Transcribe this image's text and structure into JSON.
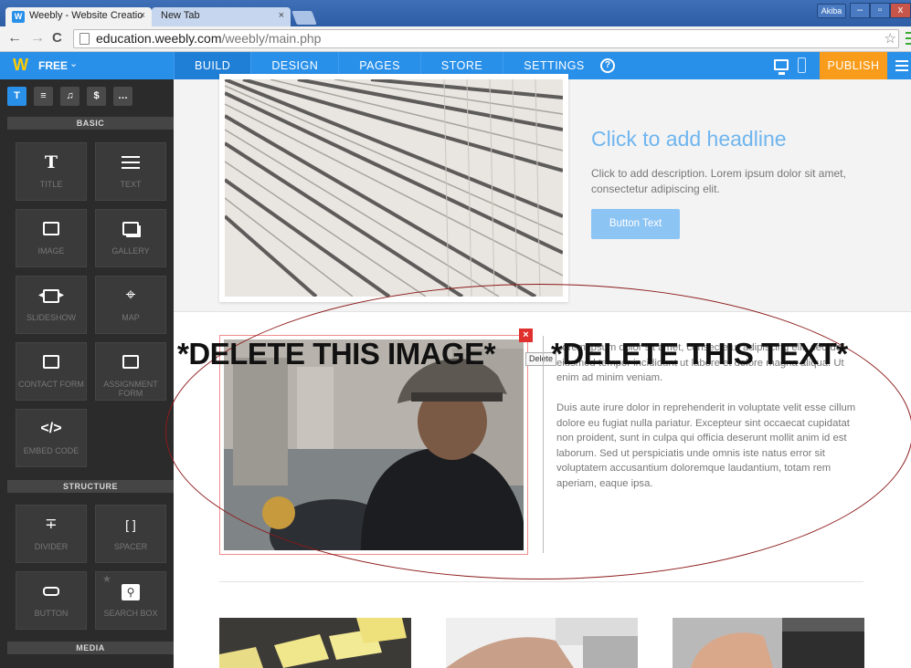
{
  "browser": {
    "active_tab_title": "Weebly - Website Creatio",
    "inactive_tab_title": "New Tab",
    "tab_close": "×",
    "window_user": "Akiba",
    "win_min": "–",
    "win_max": "▫",
    "win_close": "x",
    "url_host": "education.weebly.com",
    "url_path": "/weebly/main.php",
    "back": "←",
    "forward": "→",
    "reload": "C"
  },
  "editor": {
    "logo": "W",
    "plan": "FREE",
    "nav": [
      "BUILD",
      "DESIGN",
      "PAGES",
      "STORE",
      "SETTINGS"
    ],
    "active_nav": "BUILD",
    "help": "?",
    "publish": "PUBLISH",
    "accent": "#2990ea",
    "publish_color": "#f99c1c"
  },
  "sidebar": {
    "tabs": [
      "T",
      "≡",
      "♫",
      "$",
      "…"
    ],
    "sections": {
      "basic": "BASIC",
      "structure": "STRUCTURE",
      "media": "MEDIA"
    },
    "basic": [
      {
        "icon": "T",
        "label": "TITLE"
      },
      {
        "icon": "lines",
        "label": "TEXT"
      },
      {
        "icon": "image",
        "label": "IMAGE"
      },
      {
        "icon": "gallery",
        "label": "GALLERY"
      },
      {
        "icon": "slideshow",
        "label": "SLIDESHOW"
      },
      {
        "icon": "map-pin",
        "label": "MAP"
      },
      {
        "icon": "form",
        "label": "CONTACT FORM"
      },
      {
        "icon": "form",
        "label": "ASSIGNMENT FORM"
      },
      {
        "icon": "</>",
        "label": "EMBED CODE"
      }
    ],
    "structure": [
      {
        "icon": "divider",
        "label": "DIVIDER"
      },
      {
        "icon": "spacer",
        "label": "SPACER"
      },
      {
        "icon": "button",
        "label": "BUTTON"
      },
      {
        "icon": "search",
        "label": "SEARCH BOX"
      }
    ]
  },
  "content": {
    "headline": "Click to add headline",
    "description": "Click to add description. Lorem ipsum dolor sit amet, consectetur adipiscing elit.",
    "button_text": "Button Text",
    "delete_tooltip": "Delete",
    "delete_x": "×",
    "paragraph1": "Lorem ipsum dolor sit amet, consectetur adipiscing elit, sed do eiusmod tempor incididunt ut labore et dolore magna aliqua. Ut enim ad minim veniam.",
    "paragraph2": "Duis aute irure dolor in reprehenderit in voluptate velit esse cillum dolore eu fugiat nulla pariatur. Excepteur sint occaecat cupidatat non proident, sunt in culpa qui officia deserunt mollit anim id est laborum. Sed ut perspiciatis unde omnis iste natus error sit voluptatem accusantium doloremque laudantium, totam rem aperiam, eaque ipsa."
  },
  "annotation": {
    "image_note": "*DELETE THIS IMAGE*",
    "text_note": "*DELETE THIS TEXT*",
    "ellipse_color": "#8c1a1a"
  }
}
